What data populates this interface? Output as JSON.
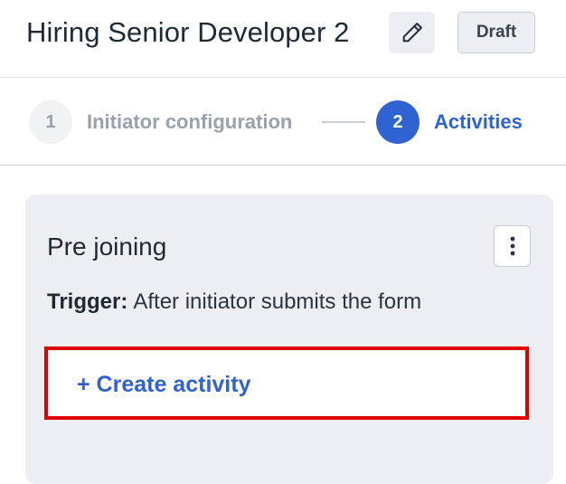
{
  "header": {
    "title": "Hiring Senior Developer 2",
    "edit_icon": "pencil-icon",
    "status_badge": "Draft"
  },
  "stepper": {
    "steps": [
      {
        "number": "1",
        "label": "Initiator configuration",
        "state": "inactive"
      },
      {
        "number": "2",
        "label": "Activities",
        "state": "active"
      }
    ]
  },
  "stage_card": {
    "title": "Pre joining",
    "menu_icon": "kebab-menu-icon",
    "trigger_label": "Trigger:",
    "trigger_value": "After initiator submits the form",
    "create_activity_label": "+ Create activity"
  },
  "colors": {
    "accent": "#2f63d1",
    "highlight": "#e00000",
    "card_bg": "#eceef1",
    "muted_text": "#9aa1ab"
  }
}
